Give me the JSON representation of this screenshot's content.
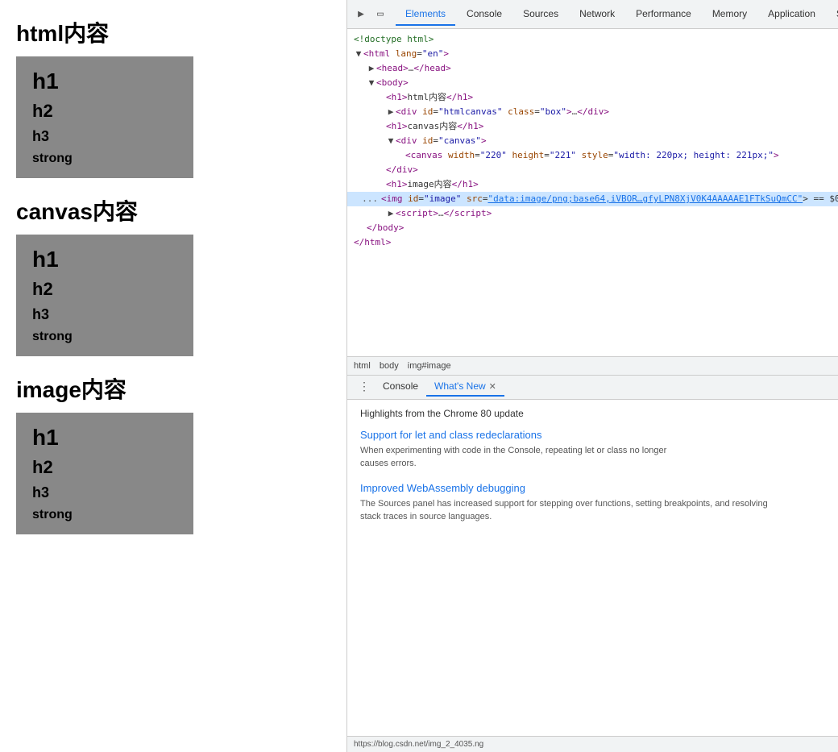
{
  "left_panel": {
    "sections": [
      {
        "title": "html内容",
        "box_items": [
          "h1",
          "h2",
          "h3",
          "strong"
        ]
      },
      {
        "title": "canvas内容",
        "box_items": [
          "h1",
          "h2",
          "h3",
          "strong"
        ]
      },
      {
        "title": "image内容",
        "box_items": [
          "h1",
          "h2",
          "h3",
          "strong"
        ]
      }
    ]
  },
  "devtools": {
    "tabs": [
      {
        "label": "Elements",
        "active": true
      },
      {
        "label": "Console",
        "active": false
      },
      {
        "label": "Sources",
        "active": false
      },
      {
        "label": "Network",
        "active": false
      },
      {
        "label": "Performance",
        "active": false
      },
      {
        "label": "Memory",
        "active": false
      },
      {
        "label": "Application",
        "active": false
      },
      {
        "label": "Se",
        "active": false
      }
    ],
    "breadcrumb": [
      "html",
      "body",
      "img#image"
    ],
    "bottom_tabs": [
      {
        "label": "Console",
        "active": false,
        "closeable": false
      },
      {
        "label": "What's New",
        "active": true,
        "closeable": true
      }
    ],
    "whats_new": {
      "header": "Highlights from the Chrome 80 update",
      "features": [
        {
          "title": "Support for let and class redeclarations",
          "desc": "When experimenting with code in the Console, repeating let or class no longer\ncauses errors."
        },
        {
          "title": "Improved WebAssembly debugging",
          "desc": "The Sources panel has increased support for stepping over functions, setting breakpoints, and resolving\nstack traces in source languages."
        }
      ]
    },
    "status_bar": "https://blog.csdn.net/img_2_4035.ng"
  }
}
